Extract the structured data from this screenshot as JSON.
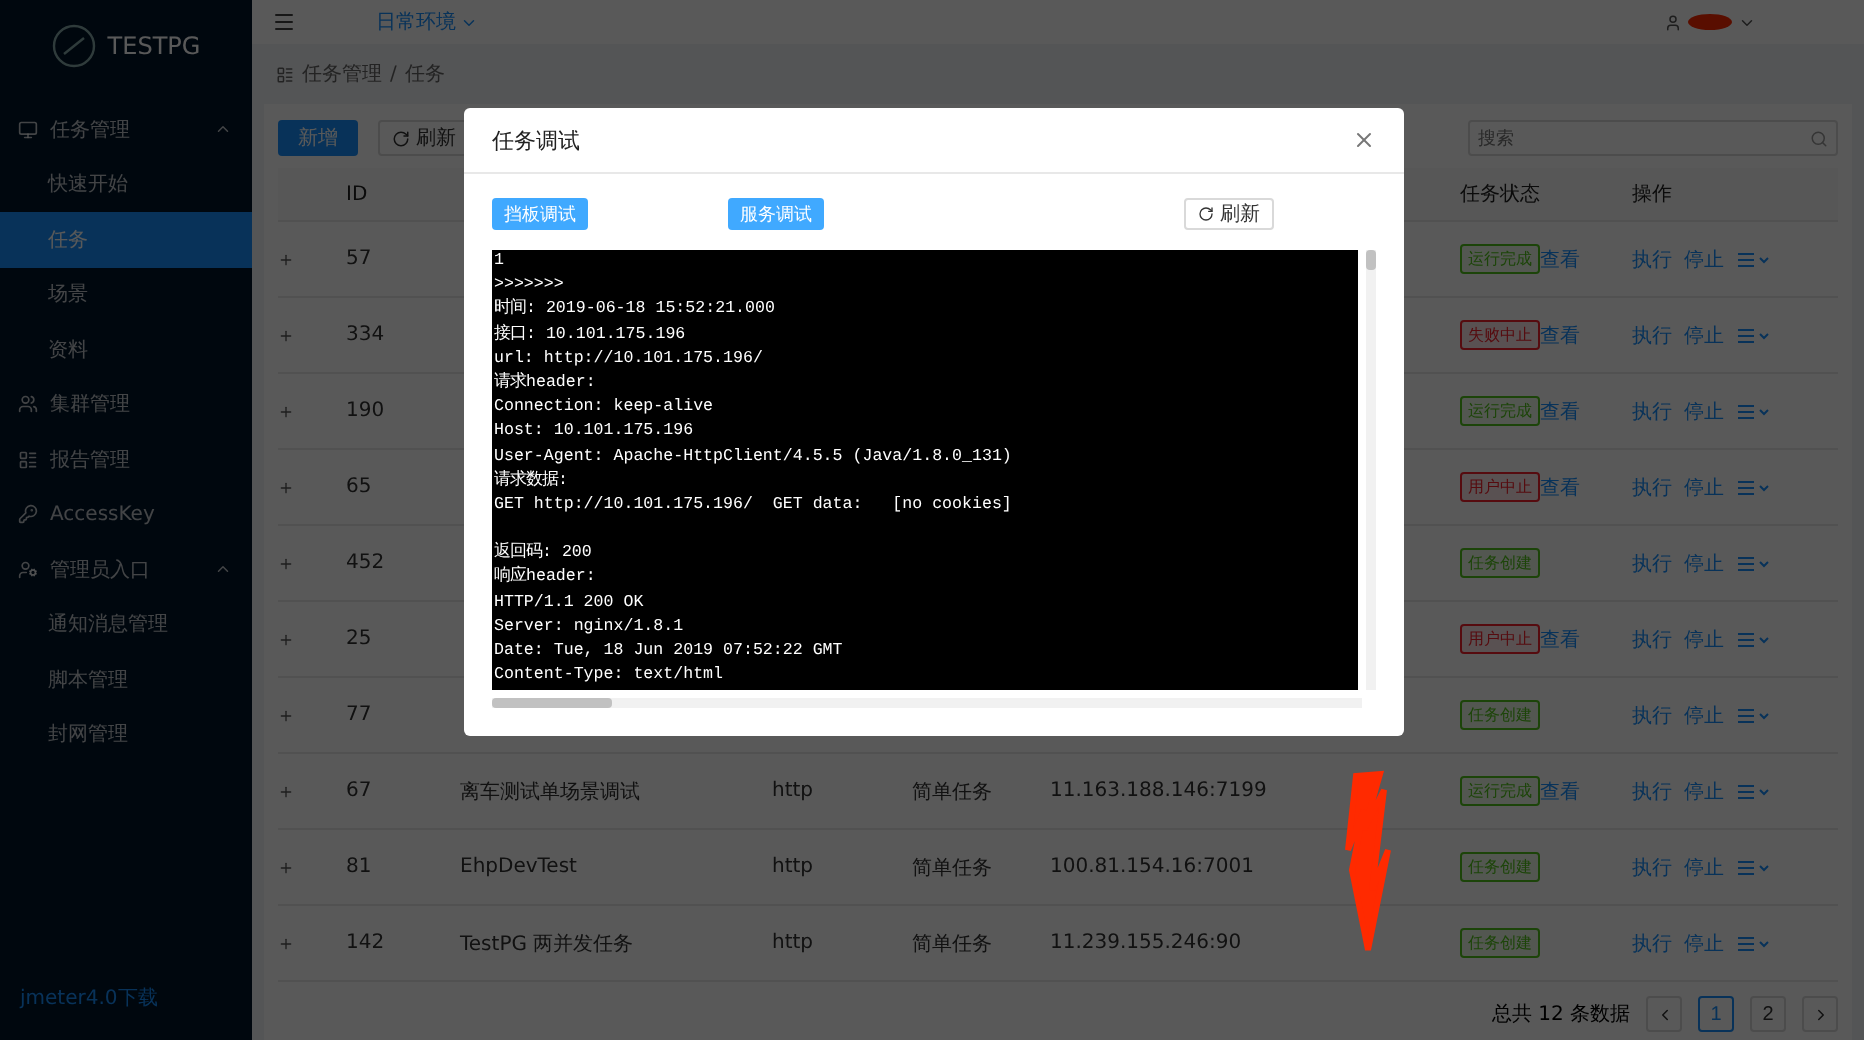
{
  "sidebar": {
    "logo": "TESTPG",
    "items": [
      {
        "label": "任务管理",
        "expanded": true,
        "selected": false,
        "children": [
          {
            "label": "快速开始",
            "selected": false
          },
          {
            "label": "任务",
            "selected": true
          },
          {
            "label": "场景",
            "selected": false
          },
          {
            "label": "资料",
            "selected": false
          }
        ]
      },
      {
        "label": "集群管理",
        "selected": false
      },
      {
        "label": "报告管理",
        "selected": false
      },
      {
        "label": "AccessKey",
        "selected": false
      },
      {
        "label": "管理员入口",
        "expanded": true,
        "selected": false,
        "children": [
          {
            "label": "通知消息管理",
            "selected": false
          },
          {
            "label": "脚本管理",
            "selected": false
          },
          {
            "label": "封网管理",
            "selected": false
          }
        ]
      }
    ],
    "footer": "jmeter4.0下载"
  },
  "header": {
    "environment": "日常环境"
  },
  "breadcrumb": {
    "separator": "/",
    "items": [
      "任务管理",
      "任务"
    ]
  },
  "toolbar": {
    "buttons": [
      "新增",
      "刷新"
    ],
    "search": {
      "placeholder": "搜索"
    }
  },
  "table": {
    "columns": [
      "ID",
      "任务状态",
      "操作"
    ],
    "rows": [
      {
        "id": "57",
        "status": {
          "label": "运行完成",
          "kind": "success"
        },
        "view": "查看",
        "actions": [
          "执行",
          "停止"
        ]
      },
      {
        "id": "334",
        "status": {
          "label": "失败中止",
          "kind": "error"
        },
        "view": "查看",
        "actions": [
          "执行",
          "停止"
        ]
      },
      {
        "id": "190",
        "status": {
          "label": "运行完成",
          "kind": "success"
        },
        "view": "查看",
        "actions": [
          "执行",
          "停止"
        ]
      },
      {
        "id": "65",
        "status": {
          "label": "用户中止",
          "kind": "error"
        },
        "view": "查看",
        "actions": [
          "执行",
          "停止"
        ]
      },
      {
        "id": "452",
        "status": {
          "label": "任务创建",
          "kind": "success"
        },
        "actions": [
          "执行",
          "停止"
        ]
      },
      {
        "id": "25",
        "status": {
          "label": "用户中止",
          "kind": "error"
        },
        "view": "查看",
        "actions": [
          "执行",
          "停止"
        ]
      },
      {
        "id": "77",
        "status": {
          "label": "任务创建",
          "kind": "success"
        },
        "actions": [
          "执行",
          "停止"
        ]
      },
      {
        "id": "67",
        "name": "离车测试单场景调试",
        "protocol": "http",
        "type": "简单任务",
        "address": "11.163.188.146:7199",
        "status": {
          "label": "运行完成",
          "kind": "success"
        },
        "view": "查看",
        "actions": [
          "执行",
          "停止"
        ]
      },
      {
        "id": "81",
        "name": "EhpDevTest",
        "protocol": "http",
        "type": "简单任务",
        "address": "100.81.154.16:7001",
        "status": {
          "label": "任务创建",
          "kind": "success"
        },
        "actions": [
          "执行",
          "停止"
        ]
      },
      {
        "id": "142",
        "name": "TestPG 两并发任务",
        "protocol": "http",
        "type": "简单任务",
        "address": "11.239.155.246:90",
        "status": {
          "label": "任务创建",
          "kind": "success"
        },
        "actions": [
          "执行",
          "停止"
        ]
      }
    ]
  },
  "pagination": {
    "total": "总共 12 条数据",
    "pages": [
      {
        "label": "1",
        "selected": true
      },
      {
        "label": "2",
        "selected": false
      }
    ]
  },
  "modal": {
    "title": "任务调试",
    "buttons": [
      {
        "label": "挡板调试",
        "kind": "primary"
      },
      {
        "label": "服务调试",
        "kind": "primary"
      },
      {
        "label": "刷新",
        "kind": "refresh"
      }
    ],
    "console": [
      [
        "1",
        ">>>>>>>",
        "时间: 2019-06-18 15:52:21.000",
        "接口: 10.101.175.196",
        "url: http://10.101.175.196/",
        "请求header:",
        "Connection: keep-alive",
        "Host: 10.101.175.196",
        "User-Agent: Apache-HttpClient/4.5.5 (Java/1.8.0_131)",
        "请求数据:",
        "GET http://10.101.175.196/  GET data:   [no cookies]"
      ],
      [
        "返回码: 200",
        "响应header:",
        "HTTP/1.1 200 OK",
        "Server: nginx/1.8.1",
        "Date: Tue, 18 Jun 2019 07:52:22 GMT",
        "Content-Type: text/html"
      ]
    ]
  }
}
